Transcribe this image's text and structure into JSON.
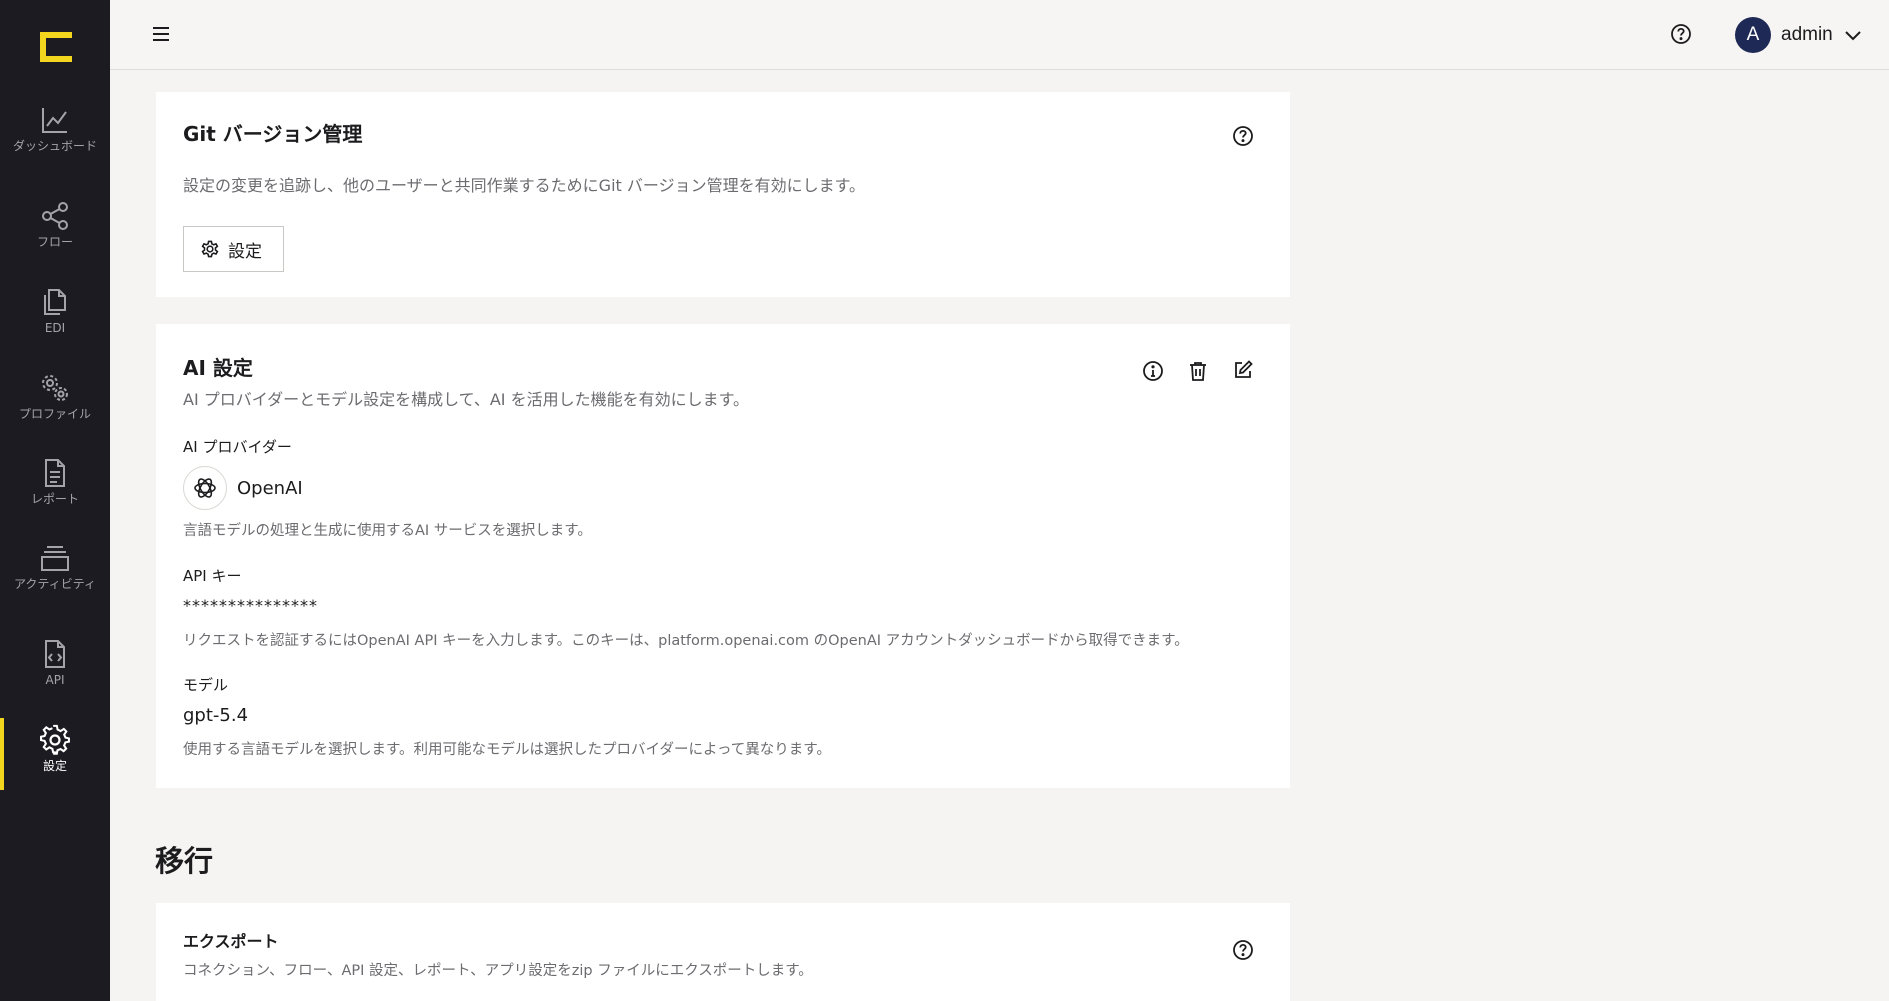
{
  "sidebar": {
    "items": [
      {
        "label": "ダッシュボード",
        "icon": "chart-line-icon"
      },
      {
        "label": "フロー",
        "icon": "share-nodes-icon"
      },
      {
        "label": "EDI",
        "icon": "documents-icon"
      },
      {
        "label": "プロファイル",
        "icon": "gears-icon"
      },
      {
        "label": "レポート",
        "icon": "report-file-icon"
      },
      {
        "label": "アクティビティ",
        "icon": "layers-stack-icon"
      },
      {
        "label": "API",
        "icon": "code-file-icon"
      },
      {
        "label": "設定",
        "icon": "gear-icon"
      }
    ],
    "active_index": 7,
    "accent_color": "#f2d51d"
  },
  "header": {
    "user": {
      "initial": "A",
      "name": "admin"
    }
  },
  "git_card": {
    "title": "Git バージョン管理",
    "description": "設定の変更を追跡し、他のユーザーと共同作業するためにGit バージョン管理を有効にします。",
    "settings_button": "設定"
  },
  "ai_card": {
    "title": "AI 設定",
    "description": "AI プロバイダーとモデル設定を構成して、AI を活用した機能を有効にします。",
    "provider_label": "AI プロバイダー",
    "provider_name": "OpenAI",
    "provider_help": "言語モデルの処理と生成に使用するAI サービスを選択します。",
    "api_key_label": "API キー",
    "api_key_value": "***************",
    "api_key_help": "リクエストを認証するにはOpenAI API キーを入力します。このキーは、platform.openai.com のOpenAI アカウントダッシュボードから取得できます。",
    "model_label": "モデル",
    "model_value": "gpt-5.4",
    "model_help": "使用する言語モデルを選択します。利用可能なモデルは選択したプロバイダーによって異なります。"
  },
  "migration": {
    "heading": "移行",
    "export_title": "エクスポート",
    "export_description": "コネクション、フロー、API 設定、レポート、アプリ設定をzip ファイルにエクスポートします。"
  }
}
